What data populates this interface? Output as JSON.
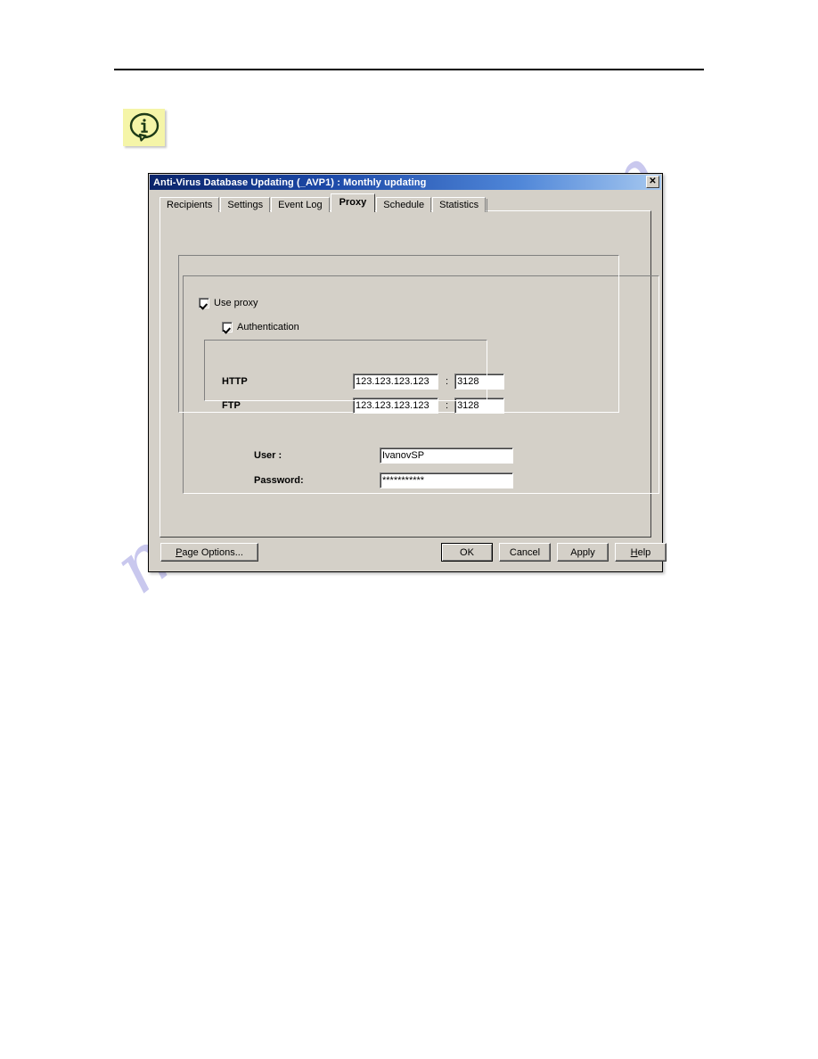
{
  "page": {
    "rule": "horizontal-rule",
    "note_icon": "info-bubble-icon",
    "watermark": "manualshive.com",
    "watermark_color": "#c9c8ee"
  },
  "dialog": {
    "title": "Anti-Virus Database Updating (_AVP1) : Monthly updating",
    "close_label": "✕",
    "titlebar_color_start": "#0a246a",
    "titlebar_color_end": "#a6c8f0",
    "face_color": "#d4d0c8"
  },
  "tabs": [
    {
      "label": "Recipients",
      "active": false
    },
    {
      "label": "Settings",
      "active": false
    },
    {
      "label": "Event Log",
      "active": false
    },
    {
      "label": "Proxy",
      "active": true
    },
    {
      "label": "Schedule",
      "active": false
    },
    {
      "label": "Statistics",
      "active": false
    }
  ],
  "proxy": {
    "use_proxy": {
      "label": "Use proxy",
      "checked": true
    },
    "http": {
      "label": "HTTP",
      "host": "123.123.123.123",
      "host_placeholder": "123.123.123.123",
      "separator": ":",
      "port": "3128",
      "port_placeholder": "3128"
    },
    "ftp": {
      "label": "FTP",
      "host": "123.123.123.123",
      "host_placeholder": "123.123.123.123",
      "separator": ":",
      "port": "3128",
      "port_placeholder": "3128"
    },
    "authentication": {
      "label": "Authentication",
      "checked": true,
      "user": {
        "label": "User :",
        "value": "IvanovSP",
        "placeholder": "IvanovSP"
      },
      "password": {
        "label": "Password:",
        "value": "***********",
        "placeholder": "***********"
      }
    }
  },
  "buttons": {
    "page_options": {
      "accel": "P",
      "rest": "age Options..."
    },
    "ok": "OK",
    "cancel": "Cancel",
    "apply": "Apply",
    "help": {
      "accel": "H",
      "rest": "elp"
    }
  }
}
